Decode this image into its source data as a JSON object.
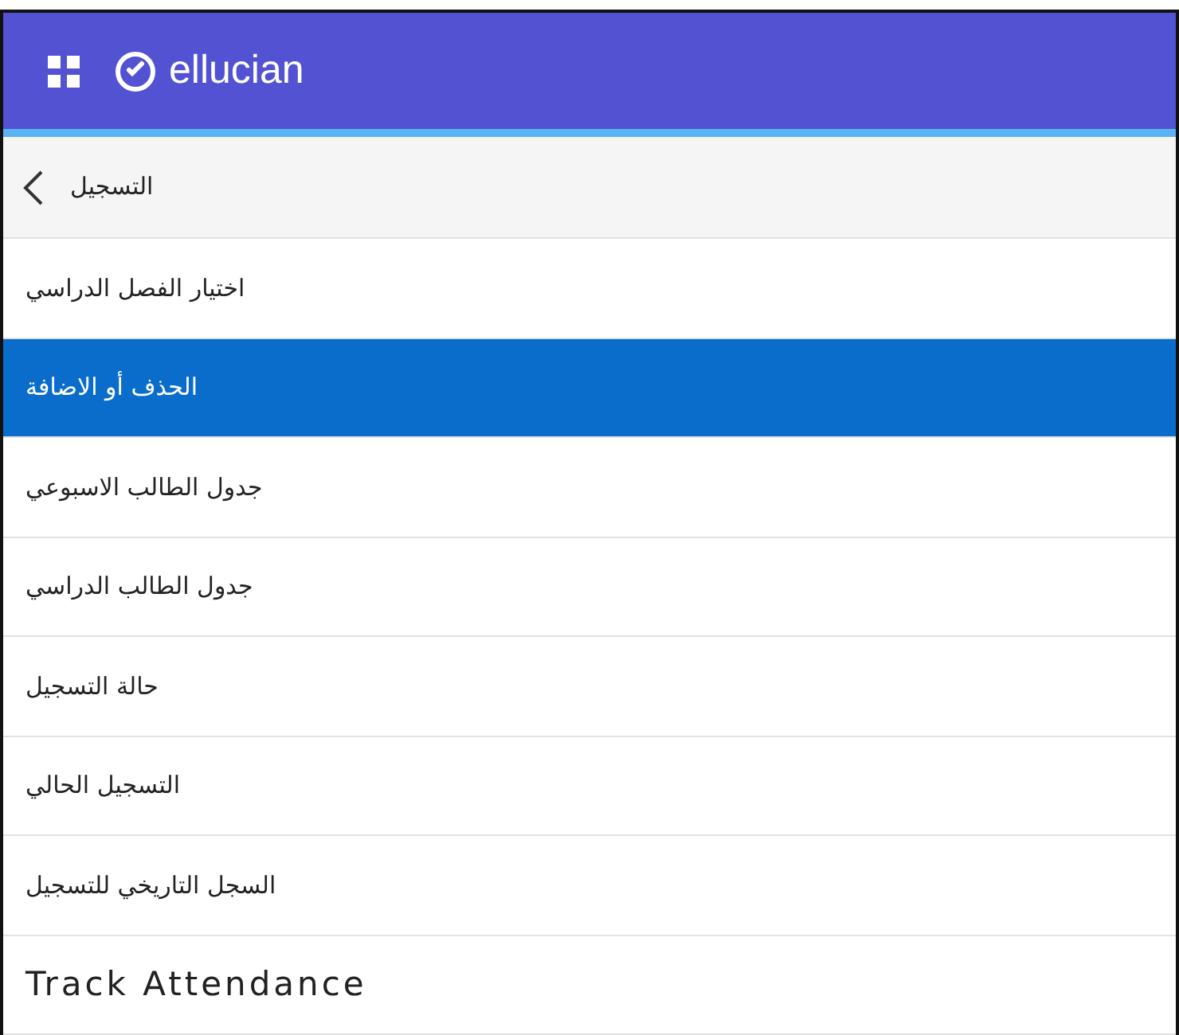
{
  "header": {
    "brand": "ellucian"
  },
  "back": {
    "label": "التسجيل"
  },
  "menu_items": [
    {
      "label": "اختيار الفصل الدراسي",
      "selected": false
    },
    {
      "label": "الحذف أو الاضافة",
      "selected": true
    },
    {
      "label": "جدول الطالب الاسبوعي",
      "selected": false
    },
    {
      "label": "جدول الطالب الدراسي",
      "selected": false
    },
    {
      "label": "حالة التسجيل",
      "selected": false
    },
    {
      "label": "التسجيل الحالي",
      "selected": false
    },
    {
      "label": "السجل التاريخي للتسجيل",
      "selected": false
    },
    {
      "label": "Track Attendance",
      "selected": false
    }
  ]
}
